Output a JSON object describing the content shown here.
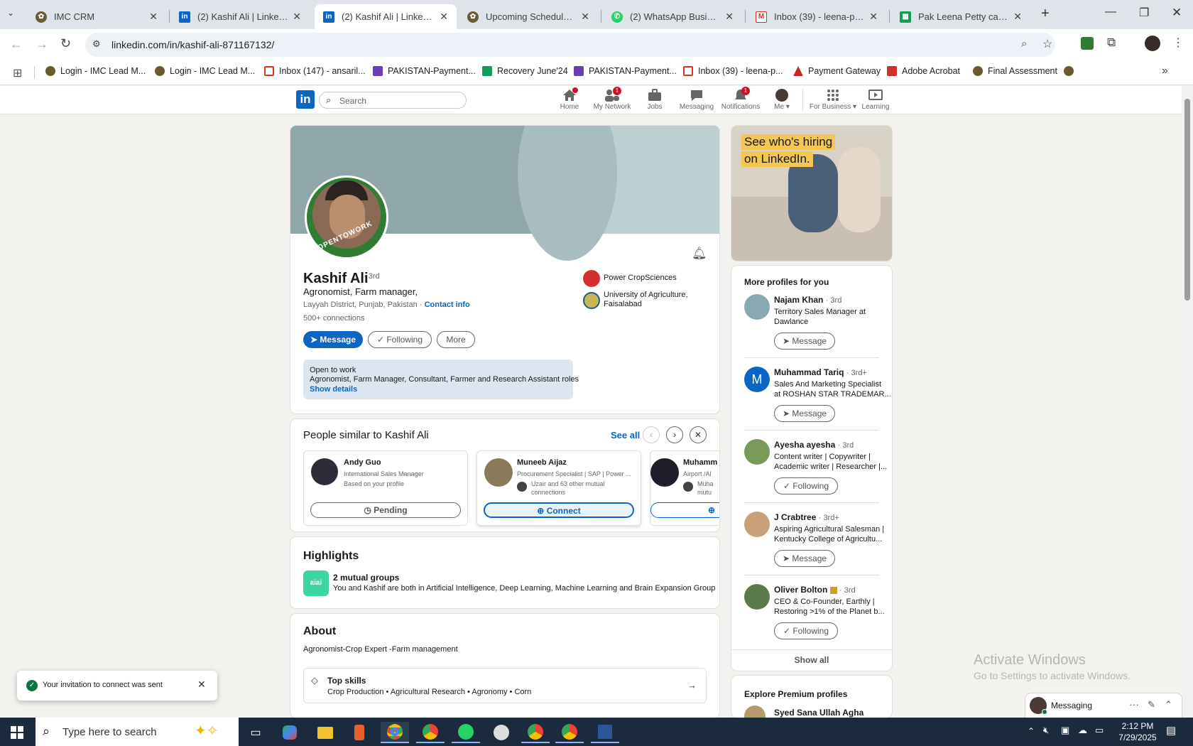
{
  "browser": {
    "tabs": [
      {
        "title": "IMC CRM",
        "icon": "imc-icon",
        "active": false
      },
      {
        "title": "(2) Kashif Ali | LinkedIn",
        "icon": "linkedin-icon",
        "active": false
      },
      {
        "title": "(2) Kashif Ali | LinkedIn",
        "icon": "linkedin-icon",
        "active": true
      },
      {
        "title": "Upcoming Schedules | IM",
        "icon": "imc-icon",
        "active": false
      },
      {
        "title": "(2) WhatsApp Business",
        "icon": "whatsapp-icon",
        "active": false
      },
      {
        "title": "Inbox (39) - leena-pk@im",
        "icon": "gmail-icon",
        "active": false
      },
      {
        "title": "Pak Leena Petty cash - Go",
        "icon": "sheets-icon",
        "active": false
      }
    ],
    "url": "linkedin.com/in/kashif-ali-871167132/",
    "bookmarks": [
      "Login - IMC Lead M...",
      "Login - IMC Lead M...",
      "Inbox (147) - ansaril...",
      "PAKISTAN-Payment...",
      "Recovery June'24",
      "PAKISTAN-Payment...",
      "Inbox (39) - leena-p...",
      "Payment Gateway",
      "Adobe Acrobat",
      "Final Assessment"
    ]
  },
  "linkedin": {
    "search_placeholder": "Search",
    "nav": {
      "home": "Home",
      "network": "My Network",
      "network_badge": "1",
      "jobs": "Jobs",
      "messaging": "Messaging",
      "notifications": "Notifications",
      "notifications_badge": "1",
      "me": "Me",
      "business": "For Business",
      "learning": "Learning"
    }
  },
  "profile": {
    "name": "Kashif Ali",
    "degree": "· 3rd",
    "headline": "Agronomist, Farm manager,",
    "location": "Layyah District, Punjab, Pakistan",
    "location_sep": " · ",
    "contact_info": "Contact info",
    "connections": "500+ connections",
    "opentowork_ring": "#OPENTOWORK",
    "buttons": {
      "message": "Message",
      "following": "Following",
      "more": "More"
    },
    "company": "Power CropSciences",
    "education_line1": "University of Agriculture,",
    "education_line2": "Faisalabad",
    "open_to_work": {
      "title": "Open to work",
      "roles": "Agronomist, Farm Manager, Consultant, Farmer and Research Assistant roles",
      "link": "Show details"
    }
  },
  "similar": {
    "title": "People similar to Kashif Ali",
    "see_all": "See all",
    "people": [
      {
        "name": "Andy Guo",
        "line1": "International Sales Manager",
        "line2": "Based on your profile",
        "button": "Pending"
      },
      {
        "name": "Muneeb Aijaz",
        "line1": "Procurement Specialist | SAP | Power ...",
        "line2": "Uzair and 63 other mutual",
        "line3": "connections",
        "button": "Connect"
      },
      {
        "name": "Muhamm",
        "line1": "Airport /Al",
        "line2": "Muha",
        "line3": "mutu",
        "button": ""
      }
    ]
  },
  "highlights": {
    "title": "Highlights",
    "groups_title": "2 mutual groups",
    "groups_desc": "You and Kashif are both in Artificial Intelligence, Deep Learning, Machine Learning and Brain Expansion Group",
    "icon_text": "aiai"
  },
  "about": {
    "title": "About",
    "text": "Agronomist-Crop Expert -Farm management",
    "skills_title": "Top skills",
    "skills": "Crop Production • Agricultural Research • Agronomy • Corn"
  },
  "ad": {
    "line1": "See who's hiring",
    "line2": "on LinkedIn."
  },
  "more_profiles": {
    "title": "More profiles for you",
    "people": [
      {
        "name": "Najam Khan",
        "degree": "· 3rd",
        "line1": "Territory Sales Manager at",
        "line2": "Dawlance",
        "button": "Message",
        "avatar": ""
      },
      {
        "name": "Muhammad Tariq",
        "degree": "· 3rd+",
        "line1": "Sales And Marketing Specialist",
        "line2": "at ROSHAN STAR TRADEMAR...",
        "button": "Message",
        "avatar": "M"
      },
      {
        "name": "Ayesha ayesha",
        "degree": "· 3rd",
        "line1": "Content writer | Copywriter |",
        "line2": "Academic writer | Researcher |...",
        "button": "Following",
        "avatar": ""
      },
      {
        "name": "J Crabtree",
        "degree": "· 3rd+",
        "line1": "Aspiring Agricultural Salesman |",
        "line2": "Kentucky College of Agricultu...",
        "button": "Message",
        "avatar": ""
      },
      {
        "name": "Oliver Bolton",
        "degree": "· 3rd",
        "line1": "CEO & Co-Founder, Earthly |",
        "line2": "Restoring >1% of the Planet b...",
        "button": "Following",
        "avatar": ""
      }
    ],
    "show_all": "Show all"
  },
  "premium": {
    "title": "Explore Premium profiles",
    "first": "Syed Sana Ullah Agha"
  },
  "toast": "Your invitation to connect was sent",
  "messaging_bar": "Messaging",
  "watermark": {
    "line1": "Activate Windows",
    "line2": "Go to Settings to activate Windows."
  },
  "taskbar": {
    "search": "Type here to search",
    "time": "2:12 PM",
    "date": "7/29/2025"
  }
}
